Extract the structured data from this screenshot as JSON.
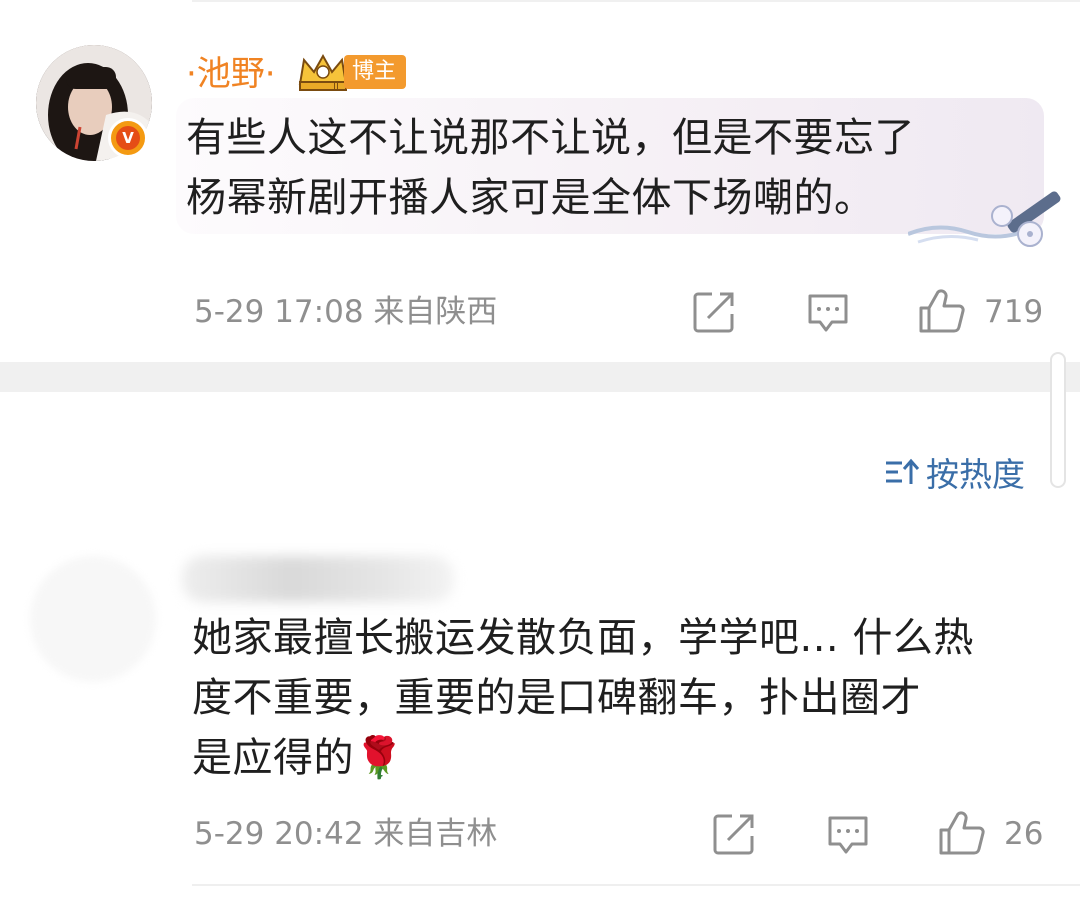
{
  "comments": [
    {
      "username": "·池野·",
      "tag": "博主",
      "verified_badge": "V",
      "text_line1": "有些人这不让说那不让说，但是不要忘了",
      "text_line2": "杨幂新剧开播人家可是全体下场嘲的。",
      "meta": "5-29 17:08 来自陕西",
      "likes": "719"
    },
    {
      "username": "",
      "text_line1": "她家最擅长搬运发散负面，学学吧... 什么热",
      "text_line2": "度不重要，重要的是口碑翻车，扑出圈才",
      "text_line3": "是应得的🌹",
      "meta": "5-29 20:42 来自吉林",
      "likes": "26"
    }
  ],
  "sort_label": "按热度",
  "icons": [
    "share-icon",
    "reply-icon",
    "like-icon",
    "sort-icon",
    "crown-icon"
  ],
  "colors": {
    "username": "#f08323",
    "tag_bg": "#f39a2e",
    "link": "#3a6ea8",
    "meta": "#8f8f8f"
  }
}
